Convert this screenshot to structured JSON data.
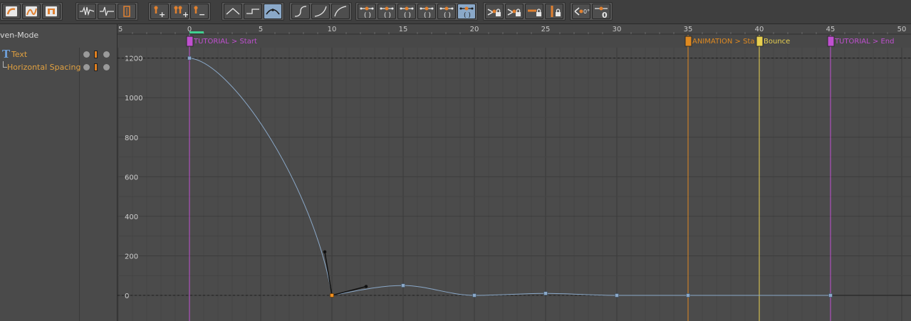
{
  "toolbar": {
    "groups": [
      {
        "name": "tool-group-edit",
        "buttons": [
          "edit-keys-icon",
          "bezier-draw-icon",
          "frame-select-icon"
        ]
      },
      {
        "name": "tool-group-curve-view",
        "buttons": [
          "waveform-icon",
          "velocity-curve-icon",
          "value-bars-icon"
        ]
      },
      {
        "name": "tool-group-key-add",
        "buttons": [
          "add-key-icon",
          "add-keys-icon",
          "remove-key-icon"
        ]
      },
      {
        "name": "tool-group-interpolation",
        "buttons": [
          "linear-interp-icon",
          "step-interp-icon",
          "spline-interp-icon"
        ]
      },
      {
        "name": "tool-group-easing",
        "buttons": [
          "ease-in-icon",
          "ease-out-icon",
          "ease-in-out-icon"
        ]
      },
      {
        "name": "tool-group-tangents",
        "buttons": [
          "tangent-clamp-icon",
          "tangent-flat-icon",
          "tangent-weight-icon",
          "tangent-overshoot-icon",
          "tangent-weight-down-icon",
          "tangent-auto-icon"
        ]
      },
      {
        "name": "tool-group-locks",
        "buttons": [
          "lock-time-icon",
          "lock-value-icon",
          "lock-horizontal-icon",
          "lock-vertical-icon"
        ]
      },
      {
        "name": "tool-group-zero",
        "buttons": [
          "zero-angle-icon",
          "zero-value-icon"
        ]
      }
    ],
    "zero_label": "0"
  },
  "left_panel": {
    "mode_label": "ven-Mode",
    "layers": [
      {
        "label": "Text",
        "icon": "text-layer-icon"
      },
      {
        "label": "Horizontal Spacing",
        "icon": "tree-branch-icon"
      }
    ]
  },
  "timeline": {
    "ruler_labels": [
      "5",
      "0",
      "5",
      "10",
      "15",
      "20",
      "25",
      "30",
      "35",
      "40",
      "45",
      "50"
    ],
    "ruler_frames": [
      -5,
      0,
      5,
      10,
      15,
      20,
      25,
      30,
      35,
      40,
      45,
      50
    ],
    "current_frame": 0,
    "markers": [
      {
        "frame": 0,
        "label": "TUTORIAL > Start",
        "color": "#c050d0"
      },
      {
        "frame": 35,
        "label": "ANIMATION > Sta",
        "color": "#e08a20"
      },
      {
        "frame": 40,
        "label": "Bounce",
        "color": "#e8d050"
      },
      {
        "frame": 45,
        "label": "TUTORIAL > End",
        "color": "#c050d0"
      }
    ]
  },
  "curve_graph": {
    "y_labels": [
      "1200",
      "1000",
      "800",
      "600",
      "400",
      "200",
      "0"
    ],
    "y_values": [
      1200,
      1000,
      800,
      600,
      400,
      200,
      0
    ],
    "curve_color": "#8aa8c8",
    "keyframes": [
      {
        "frame": 0,
        "value": 1200
      },
      {
        "frame": 10,
        "value": 0
      },
      {
        "frame": 15,
        "value": 50
      },
      {
        "frame": 20,
        "value": 0
      },
      {
        "frame": 25,
        "value": 10
      },
      {
        "frame": 30,
        "value": 0
      },
      {
        "frame": 35,
        "value": 0
      },
      {
        "frame": 45,
        "value": 0
      }
    ],
    "selected_key": {
      "frame": 10,
      "value": 0,
      "in_handle": {
        "frame": 9.5,
        "value": 220
      },
      "out_handle": {
        "frame": 12.4,
        "value": 45
      }
    }
  }
}
